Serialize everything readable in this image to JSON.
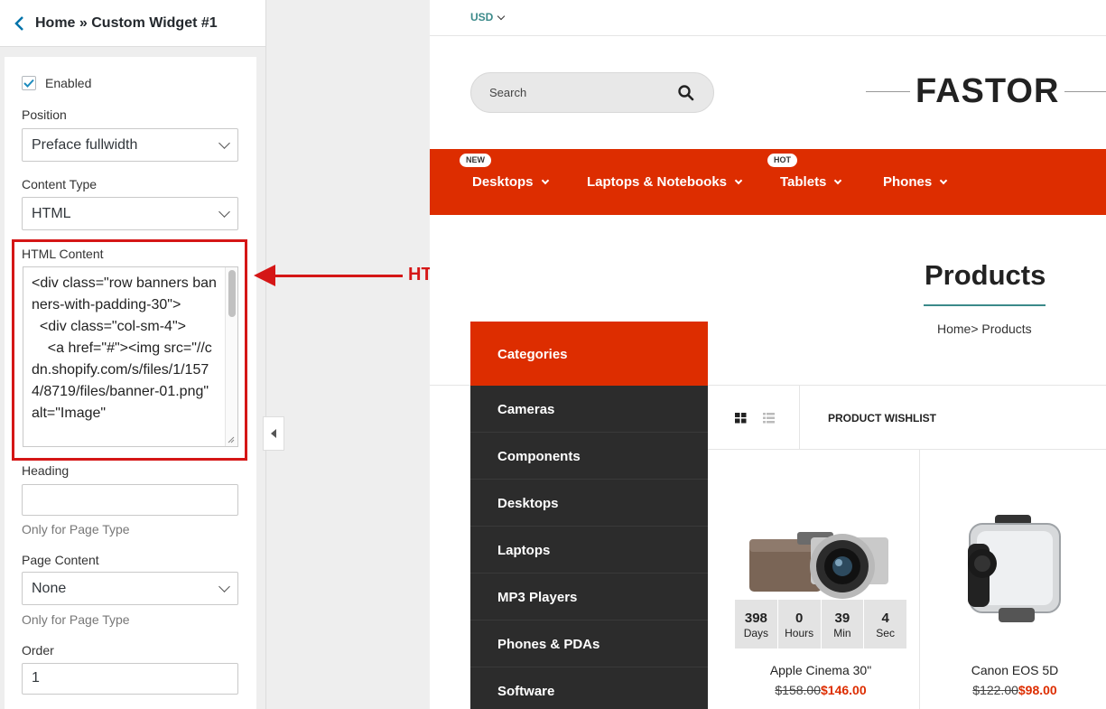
{
  "panel": {
    "breadcrumb": "Home » Custom Widget #1",
    "enabled_label": "Enabled",
    "enabled_checked": true,
    "position_label": "Position",
    "position_value": "Preface fullwidth",
    "content_type_label": "Content Type",
    "content_type_value": "HTML",
    "html_content_label": "HTML Content",
    "html_content_value": "<div class=\"row banners banners-with-padding-30\">\n  <div class=\"col-sm-4\">\n    <a href=\"#\"><img src=\"//cdn.shopify.com/s/files/1/1574/8719/files/banner-01.png\" alt=\"Image\"",
    "heading_label": "Heading",
    "heading_value": "",
    "heading_hint": "Only for Page Type",
    "page_content_label": "Page Content",
    "page_content_value": "None",
    "page_content_hint": "Only for Page Type",
    "order_label": "Order",
    "order_value": "1"
  },
  "annotation": {
    "text": "HTML content",
    "color": "#d51616"
  },
  "store": {
    "currency": "USD",
    "search_placeholder": "Search",
    "logo": "FASTOR",
    "nav": [
      {
        "label": "Desktops",
        "badge": "NEW"
      },
      {
        "label": "Laptops & Notebooks",
        "badge": ""
      },
      {
        "label": "Tablets",
        "badge": "HOT"
      },
      {
        "label": "Phones",
        "badge": ""
      }
    ],
    "page_title": "Products",
    "breadcrumb": "Home> Products",
    "categories_title": "Categories",
    "categories": [
      "Cameras",
      "Components",
      "Desktops",
      "Laptops",
      "MP3 Players",
      "Phones & PDAs",
      "Software"
    ],
    "wishlist": "PRODUCT WISHLIST",
    "timer": [
      {
        "num": "398",
        "label": "Days"
      },
      {
        "num": "0",
        "label": "Hours"
      },
      {
        "num": "39",
        "label": "Min"
      },
      {
        "num": "4",
        "label": "Sec"
      }
    ],
    "products": [
      {
        "name": "Apple Cinema 30\"",
        "old_price": "$158.00",
        "price": "$146.00"
      },
      {
        "name": "Canon EOS 5D",
        "old_price": "$122.00",
        "price": "$98.00"
      }
    ],
    "accent_color": "#dd2d00"
  }
}
